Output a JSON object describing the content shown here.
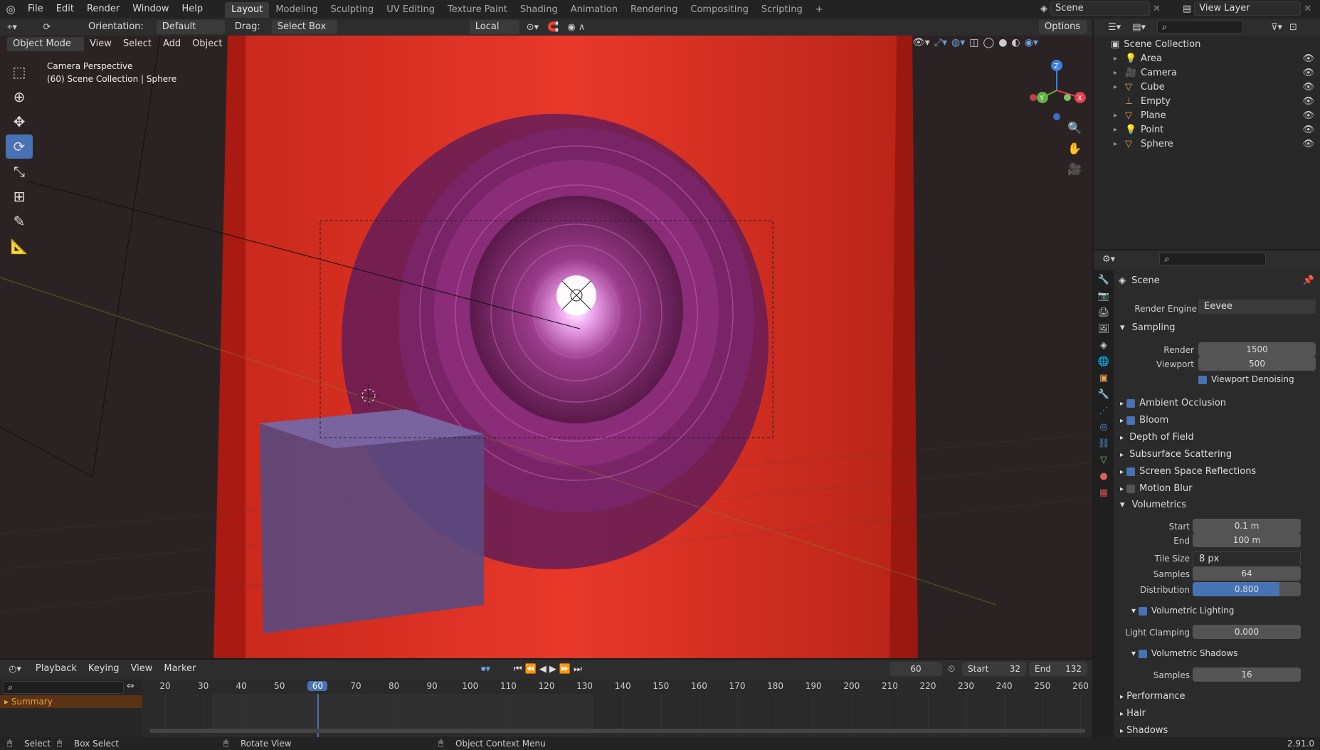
{
  "topbar": {
    "menus": [
      "File",
      "Edit",
      "Render",
      "Window",
      "Help"
    ],
    "workspaces": [
      "Layout",
      "Modeling",
      "Sculpting",
      "UV Editing",
      "Texture Paint",
      "Shading",
      "Animation",
      "Rendering",
      "Compositing",
      "Scripting"
    ],
    "add_tab": "+",
    "scene_name": "Scene",
    "view_layer": "View Layer"
  },
  "tool_header": {
    "orientation_label": "Orientation:",
    "orientation_value": "Default",
    "drag_label": "Drag:",
    "drag_value": "Select Box",
    "transform_space": "Local",
    "options": "Options"
  },
  "viewport_header": {
    "mode": "Object Mode",
    "menus": [
      "View",
      "Select",
      "Add",
      "Object"
    ]
  },
  "viewport": {
    "info_line1": "Camera Perspective",
    "info_line2": "(60) Scene Collection | Sphere",
    "gizmo_z": "Z",
    "gizmo_y": "Y",
    "gizmo_x": "X"
  },
  "outliner": {
    "search_placeholder": "",
    "root": "Scene Collection",
    "items": [
      {
        "name": "Area",
        "color": "#e8a050"
      },
      {
        "name": "Camera",
        "color": "#e8a050"
      },
      {
        "name": "Cube",
        "color": "#e8a050"
      },
      {
        "name": "Empty",
        "color": "#e8a050"
      },
      {
        "name": "Plane",
        "color": "#e8a050"
      },
      {
        "name": "Point",
        "color": "#e8a050"
      },
      {
        "name": "Sphere",
        "color": "#e8a050"
      }
    ]
  },
  "properties": {
    "context": "Scene",
    "render_engine_label": "Render Engine",
    "render_engine_value": "Eevee",
    "sampling": {
      "title": "Sampling",
      "render_label": "Render",
      "render_value": "1500",
      "viewport_label": "Viewport",
      "viewport_value": "500",
      "denoise_label": "Viewport Denoising"
    },
    "sections": [
      {
        "label": "Ambient Occlusion",
        "checkbox": true,
        "checked": true
      },
      {
        "label": "Bloom",
        "checkbox": true,
        "checked": true
      },
      {
        "label": "Depth of Field",
        "checkbox": false,
        "checked": false
      },
      {
        "label": "Subsurface Scattering",
        "checkbox": false,
        "checked": false
      },
      {
        "label": "Screen Space Reflections",
        "checkbox": true,
        "checked": true
      },
      {
        "label": "Motion Blur",
        "checkbox": true,
        "checked": false
      }
    ],
    "volumetrics": {
      "title": "Volumetrics",
      "start_label": "Start",
      "start_value": "0.1 m",
      "end_label": "End",
      "end_value": "100 m",
      "tile_label": "Tile Size",
      "tile_value": "8 px",
      "samples_label": "Samples",
      "samples_value": "64",
      "distribution_label": "Distribution",
      "distribution_value": "0.800",
      "distribution_fraction": 0.8,
      "lighting_label": "Volumetric Lighting",
      "clamp_label": "Light Clamping",
      "clamp_value": "0.000",
      "shadows_label": "Volumetric Shadows",
      "shadow_samples_label": "Samples",
      "shadow_samples_value": "16"
    },
    "bottom_sections": [
      "Performance",
      "Hair",
      "Shadows"
    ]
  },
  "timeline": {
    "menus": [
      "Playback",
      "Keying",
      "View",
      "Marker"
    ],
    "current_frame": "60",
    "start_label": "Start",
    "start_value": "32",
    "end_label": "End",
    "end_value": "132",
    "ticks": [
      "20",
      "30",
      "40",
      "50",
      "60",
      "70",
      "80",
      "90",
      "100",
      "110",
      "120",
      "130",
      "140",
      "150",
      "160",
      "170",
      "180",
      "190",
      "200",
      "210",
      "220",
      "230",
      "240",
      "250",
      "260"
    ],
    "summary": "Summary"
  },
  "statusbar": {
    "select": "Select",
    "box_select": "Box Select",
    "rotate": "Rotate View",
    "context_menu": "Object Context Menu",
    "version": "2.91.0"
  }
}
